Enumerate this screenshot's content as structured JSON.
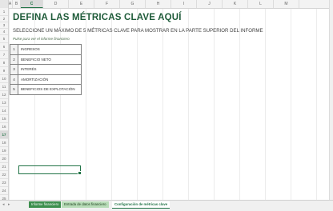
{
  "columns": [
    "A",
    "B",
    "C",
    "D",
    "E",
    "F",
    "G",
    "H",
    "I",
    "J",
    "K",
    "L",
    "M"
  ],
  "rows": [
    "1",
    "2",
    "3",
    "4",
    "5",
    "6",
    "7",
    "8",
    "9",
    "10",
    "11",
    "12",
    "13",
    "14",
    "15",
    "16",
    "17",
    "18",
    "19",
    "20",
    "21",
    "22",
    "23",
    "24",
    "25",
    "26"
  ],
  "selected_column": "C",
  "selected_row": "17",
  "sheet": {
    "title": "DEFINA LAS MÉTRICAS CLAVE AQUÍ",
    "subtitle": "SELECCIONE UN MÁXIMO DE 5 MÉTRICAS CLAVE PARA MOSTRAR EN LA PARTE SUPERIOR DEL INFORME",
    "instruction": "Pulse para ver el informe financiero"
  },
  "metrics": [
    {
      "num": "1",
      "label": "INGRESOS"
    },
    {
      "num": "2",
      "label": "BENEFICIO NETO"
    },
    {
      "num": "3",
      "label": "INTERÉS"
    },
    {
      "num": "4",
      "label": "AMORTIZACIÓN"
    },
    {
      "num": "5",
      "label": "BENEFICIOS DE EXPLOTACIÓN"
    }
  ],
  "tabs": [
    {
      "label": "Informe financiero",
      "style": "green"
    },
    {
      "label": "Entrada de datos financiero",
      "style": "green2"
    },
    {
      "label": "Configuración de métricas clave",
      "style": "active"
    }
  ],
  "nav": {
    "prev": "◂",
    "next": "▸"
  },
  "colors": {
    "accent": "#217346",
    "title": "#1e5b39"
  }
}
